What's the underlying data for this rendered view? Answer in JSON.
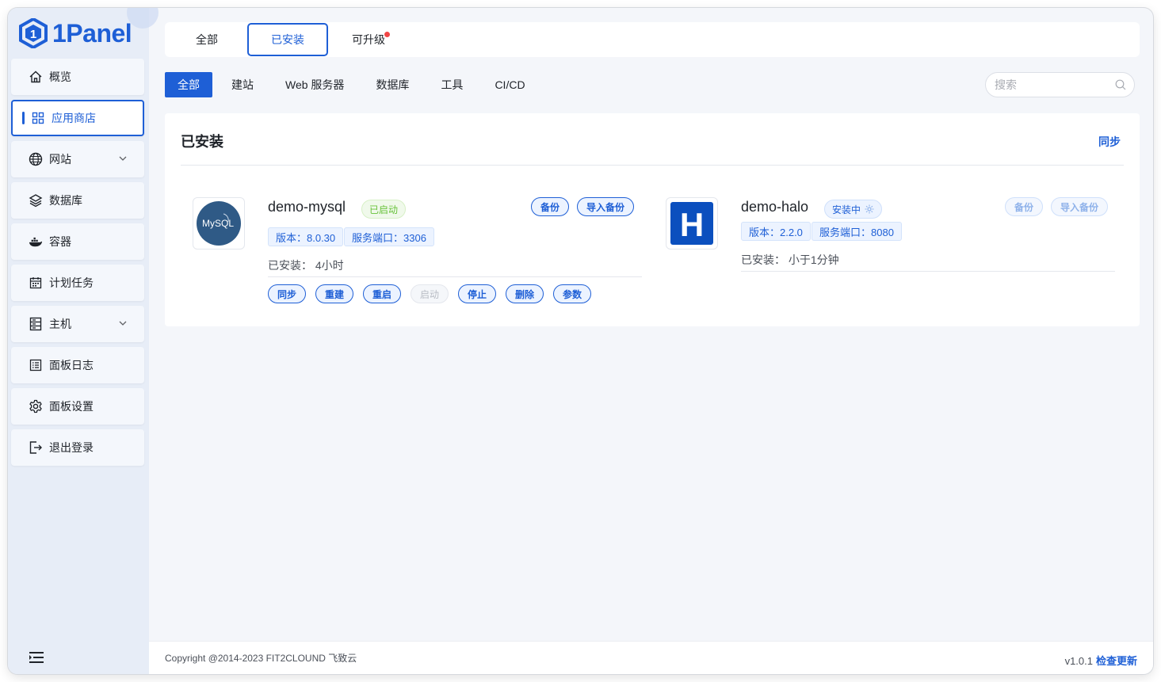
{
  "app": {
    "name": "1Panel"
  },
  "sidebar": {
    "items": [
      {
        "label": "概览",
        "icon": "home-icon"
      },
      {
        "label": "应用商店",
        "icon": "grid-icon",
        "active": true
      },
      {
        "label": "网站",
        "icon": "globe-icon",
        "expandable": true
      },
      {
        "label": "数据库",
        "icon": "layers-icon"
      },
      {
        "label": "容器",
        "icon": "docker-icon"
      },
      {
        "label": "计划任务",
        "icon": "calendar-icon"
      },
      {
        "label": "主机",
        "icon": "server-icon",
        "expandable": true
      },
      {
        "label": "面板日志",
        "icon": "log-icon"
      },
      {
        "label": "面板设置",
        "icon": "gear-icon"
      },
      {
        "label": "退出登录",
        "icon": "logout-icon"
      }
    ]
  },
  "top_tabs": [
    {
      "label": "全部"
    },
    {
      "label": "已安装",
      "active": true
    },
    {
      "label": "可升级",
      "badge_dot": true
    }
  ],
  "categories": [
    "全部",
    "建站",
    "Web 服务器",
    "数据库",
    "工具",
    "CI/CD"
  ],
  "search": {
    "placeholder": "搜索"
  },
  "panel": {
    "title": "已安装",
    "sync_label": "同步",
    "apps": [
      {
        "name": "demo-mysql",
        "status": "已启动",
        "version_tag": "版本：8.0.30",
        "port_tag": "服务端口：3306",
        "installed": "已安装：  4小时",
        "top_actions": [
          "备份",
          "导入备份"
        ],
        "actions": [
          "同步",
          "重建",
          "重启",
          "启动",
          "停止",
          "删除",
          "参数"
        ],
        "icon_text": "MySQL"
      },
      {
        "name": "demo-halo",
        "status": "安装中",
        "version_tag": "版本：2.2.0",
        "port_tag": "服务端口：8080",
        "installed": "已安装：  小于1分钟",
        "top_actions": [
          "备份",
          "导入备份"
        ],
        "icon_text": "H"
      }
    ]
  },
  "footer": {
    "copyright": "Copyright @2014-2023 FIT2CLOUND 飞致云",
    "version": "v1.0.1",
    "update_label": "检查更新"
  },
  "colors": {
    "primary": "#1e5fd6",
    "success": "#67c23a",
    "sidebar_bg": "#e7edf7",
    "page_bg": "#f4f6fa"
  }
}
